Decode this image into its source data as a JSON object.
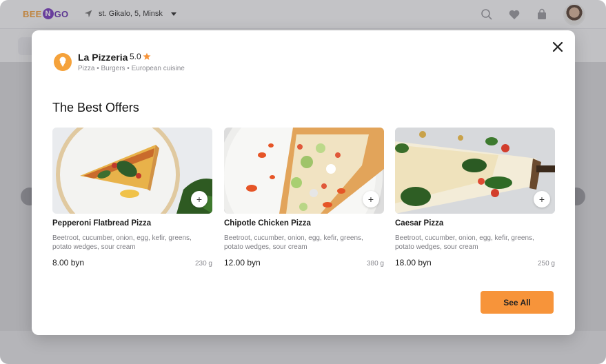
{
  "app": {
    "logo": {
      "part1": "BEE",
      "part2": "N",
      "part3": "GO"
    },
    "location": "st. Gikalo, 5, Minsk",
    "icons": [
      "search-icon",
      "heart-icon",
      "bag-icon"
    ],
    "accent_color": "#f7943a"
  },
  "restaurant": {
    "name": "La Pizzeria",
    "rating": "5.0",
    "tags": "Pizza • Burgers • European cuisine"
  },
  "offers": {
    "title": "The Best Offers",
    "items": [
      {
        "name": "Pepperoni Flatbread Pizza",
        "description": "Beetroot, cucumber, onion, egg, kefir, greens, potato wedges, sour cream",
        "price": "8.00 byn",
        "weight": "230 g",
        "add_label": "+"
      },
      {
        "name": "Chipotle Chicken Pizza",
        "description": "Beetroot, cucumber, onion, egg, kefir, greens, potato wedges, sour cream",
        "price": "12.00 byn",
        "weight": "380 g",
        "add_label": "+"
      },
      {
        "name": "Caesar Pizza",
        "description": "Beetroot, cucumber, onion, egg, kefir, greens, potato wedges, sour cream",
        "price": "18.00 byn",
        "weight": "250 g",
        "add_label": "+"
      }
    ],
    "see_all_label": "See All"
  }
}
